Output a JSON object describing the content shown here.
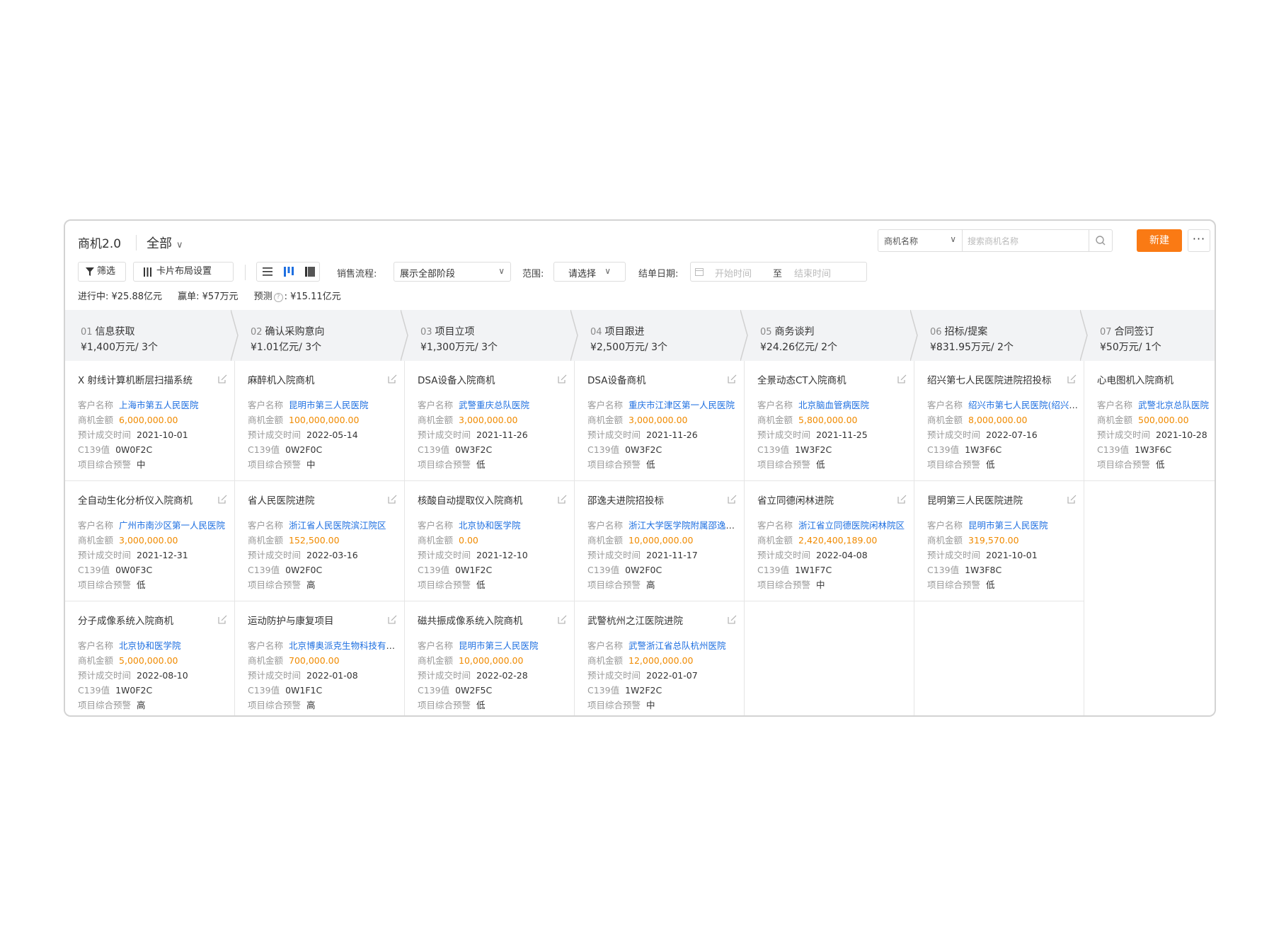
{
  "header": {
    "title": "商机2.0",
    "scope": "全部",
    "search_select": "商机名称",
    "search_placeholder": "搜索商机名称",
    "new_button": "新建",
    "more_button": "···"
  },
  "toolbar": {
    "filter_label": "筛选",
    "layout_label": "卡片布局设置",
    "sales_flow_label": "销售流程:",
    "sales_flow_value": "展示全部阶段",
    "range_label": "范围:",
    "range_value": "请选择",
    "close_date_label": "结单日期:",
    "date_start_placeholder": "开始时间",
    "date_to": "至",
    "date_end_placeholder": "结束时间"
  },
  "stats": {
    "in_progress": "进行中: ¥25.88亿元",
    "won": "赢单: ¥57万元",
    "forecast_label": "预测",
    "forecast_value": ": ¥15.11亿元"
  },
  "labels": {
    "customer": "客户名称",
    "amount": "商机金额",
    "date": "预计成交时间",
    "c139": "C139值",
    "warning": "项目综合预警"
  },
  "stages": [
    {
      "num": "01",
      "name": "信息获取",
      "summary": "¥1,400万元/ 3个"
    },
    {
      "num": "02",
      "name": "确认采购意向",
      "summary": "¥1.01亿元/ 3个"
    },
    {
      "num": "03",
      "name": "项目立项",
      "summary": "¥1,300万元/ 3个"
    },
    {
      "num": "04",
      "name": "项目跟进",
      "summary": "¥2,500万元/ 3个"
    },
    {
      "num": "05",
      "name": "商务谈判",
      "summary": "¥24.26亿元/ 2个"
    },
    {
      "num": "06",
      "name": "招标/提案",
      "summary": "¥831.95万元/ 2个"
    },
    {
      "num": "07",
      "name": "合同签订",
      "summary": "¥50万元/ 1个"
    }
  ],
  "columns": [
    [
      {
        "title": "X 射线计算机断层扫描系统",
        "customer": "上海市第五人民医院",
        "amount": "6,000,000.00",
        "date": "2021-10-01",
        "c139": "0W0F2C",
        "warning": "中"
      },
      {
        "title": "全自动生化分析仪入院商机",
        "customer": "广州市南沙区第一人民医院",
        "amount": "3,000,000.00",
        "date": "2021-12-31",
        "c139": "0W0F3C",
        "warning": "低"
      },
      {
        "title": "分子成像系统入院商机",
        "customer": "北京协和医学院",
        "amount": "5,000,000.00",
        "date": "2022-08-10",
        "c139": "1W0F2C",
        "warning": "高"
      }
    ],
    [
      {
        "title": "麻醉机入院商机",
        "customer": "昆明市第三人民医院",
        "amount": "100,000,000.00",
        "date": "2022-05-14",
        "c139": "0W2F0C",
        "warning": "中"
      },
      {
        "title": "省人民医院进院",
        "customer": "浙江省人民医院滨江院区",
        "amount": "152,500.00",
        "date": "2022-03-16",
        "c139": "0W2F0C",
        "warning": "高"
      },
      {
        "title": "运动防护与康复项目",
        "customer": "北京博奥派克生物科技有限公司",
        "amount": "700,000.00",
        "date": "2022-01-08",
        "c139": "0W1F1C",
        "warning": "高"
      }
    ],
    [
      {
        "title": "DSA设备入院商机",
        "customer": "武警重庆总队医院",
        "amount": "3,000,000.00",
        "date": "2021-11-26",
        "c139": "0W3F2C",
        "warning": "低"
      },
      {
        "title": "核酸自动提取仪入院商机",
        "customer": "北京协和医学院",
        "amount": "0.00",
        "date": "2021-12-10",
        "c139": "0W1F2C",
        "warning": "低"
      },
      {
        "title": "磁共振成像系统入院商机",
        "customer": "昆明市第三人民医院",
        "amount": "10,000,000.00",
        "date": "2022-02-28",
        "c139": "0W2F5C",
        "warning": "低"
      }
    ],
    [
      {
        "title": "DSA设备商机",
        "customer": "重庆市江津区第一人民医院",
        "amount": "3,000,000.00",
        "date": "2021-11-26",
        "c139": "0W3F2C",
        "warning": "低"
      },
      {
        "title": "邵逸夫进院招投标",
        "customer": "浙江大学医学院附属邵逸夫医院",
        "amount": "10,000,000.00",
        "date": "2021-11-17",
        "c139": "0W2F0C",
        "warning": "高"
      },
      {
        "title": "武警杭州之江医院进院",
        "customer": "武警浙江省总队杭州医院",
        "amount": "12,000,000.00",
        "date": "2022-01-07",
        "c139": "1W2F2C",
        "warning": "中"
      }
    ],
    [
      {
        "title": "全景动态CT入院商机",
        "customer": "北京脑血管病医院",
        "amount": "5,800,000.00",
        "date": "2021-11-25",
        "c139": "1W3F2C",
        "warning": "低"
      },
      {
        "title": "省立同德闲林进院",
        "customer": "浙江省立同德医院闲林院区",
        "amount": "2,420,400,189.00",
        "date": "2022-04-08",
        "c139": "1W1F7C",
        "warning": "中"
      }
    ],
    [
      {
        "title": "绍兴第七人民医院进院招投标",
        "customer": "绍兴市第七人民医院(绍兴市精神卫生中心)",
        "amount": "8,000,000.00",
        "date": "2022-07-16",
        "c139": "1W3F6C",
        "warning": "低"
      },
      {
        "title": "昆明第三人民医院进院",
        "customer": "昆明市第三人民医院",
        "amount": "319,570.00",
        "date": "2021-10-01",
        "c139": "1W3F8C",
        "warning": "低"
      }
    ],
    [
      {
        "title": "心电图机入院商机",
        "customer": "武警北京总队医院",
        "amount": "500,000.00",
        "date": "2021-10-28",
        "c139": "1W3F6C",
        "warning": "低"
      }
    ]
  ]
}
